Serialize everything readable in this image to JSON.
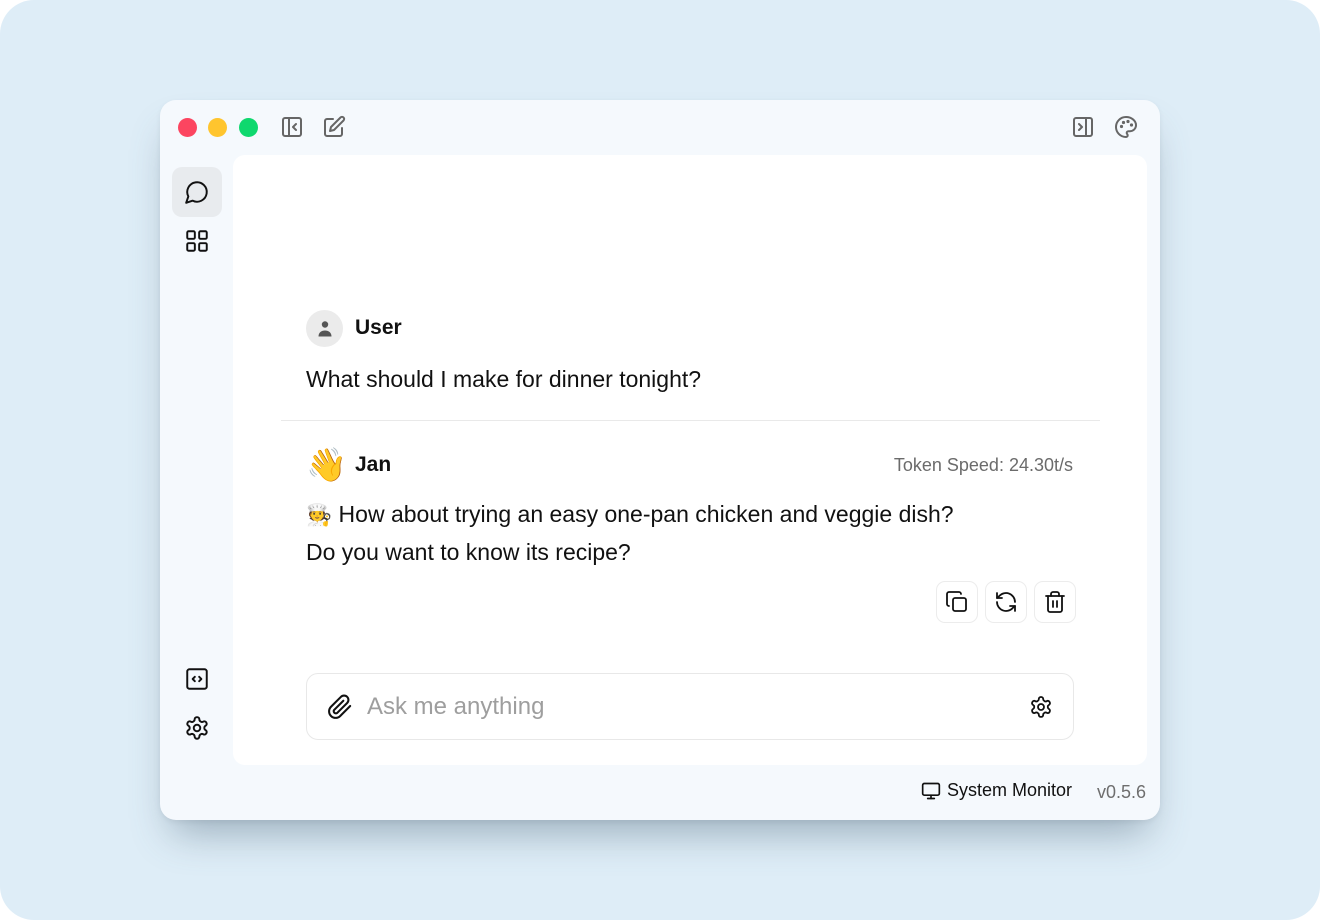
{
  "window": {
    "traffic_lights": {
      "close": "#fc4560",
      "minimize": "#ffc52e",
      "maximize": "#0fd86e"
    },
    "titlebar_left_icons": [
      "collapse-sidebar-icon",
      "new-chat-icon"
    ],
    "titlebar_right_icons": [
      "toggle-right-panel-icon",
      "palette-icon"
    ]
  },
  "nav": {
    "top": [
      {
        "name": "chat",
        "icon": "chat-bubble-icon",
        "active": true
      },
      {
        "name": "hub",
        "icon": "grid-icon",
        "active": false
      }
    ],
    "bottom": [
      {
        "name": "local-api-server",
        "icon": "code-icon"
      },
      {
        "name": "settings",
        "icon": "gear-icon"
      }
    ]
  },
  "conversation": {
    "messages": [
      {
        "role": "user",
        "sender": "User",
        "avatar": "user-icon",
        "text": "What should I make for dinner tonight?"
      },
      {
        "role": "assistant",
        "sender": "Jan",
        "avatar_emoji": "👋",
        "token_speed": "Token Speed: 24.30t/s",
        "lead_emoji": "🧑‍🍳",
        "lines": [
          "How about trying an easy one-pan chicken and veggie dish?",
          "Do you want to know its recipe?"
        ],
        "actions": [
          "copy-icon",
          "regenerate-icon",
          "delete-icon"
        ]
      }
    ]
  },
  "composer": {
    "placeholder": "Ask me anything",
    "value": ""
  },
  "statusbar": {
    "system_monitor": "System Monitor",
    "version": "v0.5.6"
  }
}
